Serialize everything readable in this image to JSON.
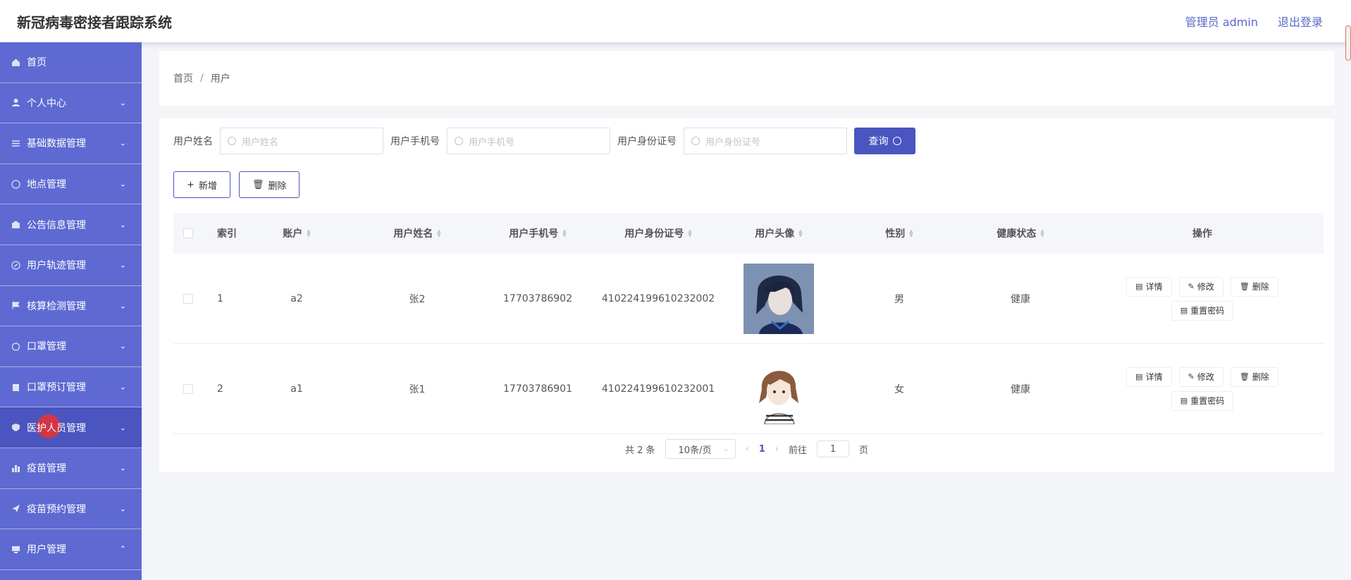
{
  "header": {
    "title": "新冠病毒密接者跟踪系统",
    "user": "管理员 admin",
    "logout": "退出登录"
  },
  "sidebar": {
    "items": [
      {
        "label": "首页",
        "icon": "home-icon",
        "arrow": ""
      },
      {
        "label": "个人中心",
        "icon": "user-icon",
        "arrow": "⌄"
      },
      {
        "label": "基础数据管理",
        "icon": "sliders-icon",
        "arrow": "⌄"
      },
      {
        "label": "地点管理",
        "icon": "globe-icon",
        "arrow": "⌄"
      },
      {
        "label": "公告信息管理",
        "icon": "briefcase-icon",
        "arrow": "⌄"
      },
      {
        "label": "用户轨迹管理",
        "icon": "compass-icon",
        "arrow": "⌄"
      },
      {
        "label": "核算检测管理",
        "icon": "flag-icon",
        "arrow": "⌄"
      },
      {
        "label": "口罩管理",
        "icon": "timer-icon",
        "arrow": "⌄"
      },
      {
        "label": "口罩预订管理",
        "icon": "clipboard-icon",
        "arrow": "⌄"
      },
      {
        "label": "医护人员管理",
        "icon": "shield-icon",
        "arrow": "⌄"
      },
      {
        "label": "疫苗管理",
        "icon": "bar-chart-icon",
        "arrow": "⌄"
      },
      {
        "label": "疫苗预约管理",
        "icon": "send-icon",
        "arrow": "⌄"
      },
      {
        "label": "用户管理",
        "icon": "monitor-icon",
        "arrow": "⌃"
      }
    ]
  },
  "breadcrumb": {
    "home": "首页",
    "sep": "/",
    "current": "用户"
  },
  "search": {
    "name_label": "用户姓名",
    "name_placeholder": "用户姓名",
    "phone_label": "用户手机号",
    "phone_placeholder": "用户手机号",
    "id_label": "用户身份证号",
    "id_placeholder": "用户身份证号",
    "query": "查询"
  },
  "actions": {
    "add": "新增",
    "delete": "删除"
  },
  "table": {
    "headers": {
      "index": "索引",
      "account": "账户",
      "name": "用户姓名",
      "phone": "用户手机号",
      "id_card": "用户身份证号",
      "avatar": "用户头像",
      "sex": "性别",
      "health": "健康状态",
      "ops": "操作"
    },
    "ops": {
      "detail": "详情",
      "edit": "修改",
      "delete": "删除",
      "reset": "重置密码"
    },
    "rows": [
      {
        "index": "1",
        "account": "a2",
        "name": "张2",
        "phone": "17703786902",
        "id_card": "410224199610232002",
        "sex": "男",
        "health": "健康"
      },
      {
        "index": "2",
        "account": "a1",
        "name": "张1",
        "phone": "17703786901",
        "id_card": "410224199610232001",
        "sex": "女",
        "health": "健康"
      }
    ]
  },
  "pagination": {
    "total": "共 2 条",
    "page_size": "10条/页",
    "current_page": "1",
    "goto_label": "前往",
    "goto_value": "1",
    "page_unit": "页"
  },
  "colors": {
    "sidebar": "#5e6ad2",
    "primary": "#4a55bf",
    "link": "#5b67c7"
  }
}
